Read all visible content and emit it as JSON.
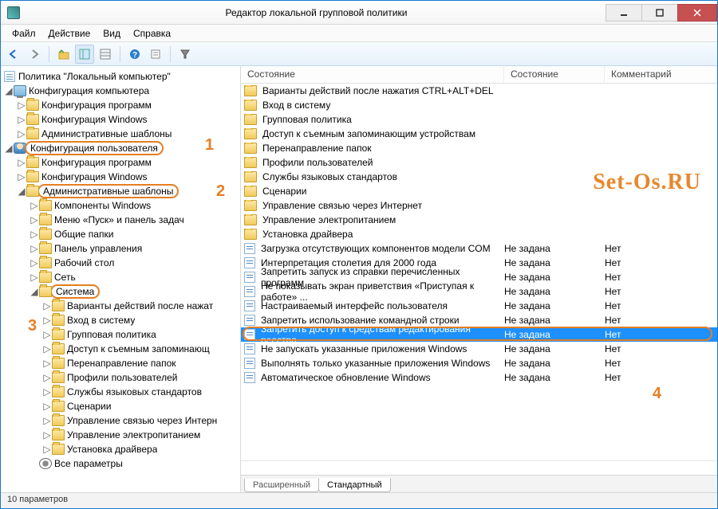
{
  "window": {
    "title": "Редактор локальной групповой политики"
  },
  "menu": {
    "file": "Файл",
    "action": "Действие",
    "view": "Вид",
    "help": "Справка"
  },
  "tree": {
    "root": "Политика \"Локальный компьютер\"",
    "computer_config": "Конфигурация компьютера",
    "computer_children": [
      "Конфигурация программ",
      "Конфигурация Windows",
      "Административные шаблоны"
    ],
    "user_config": "Конфигурация пользователя",
    "user_prog": "Конфигурация программ",
    "user_win": "Конфигурация Windows",
    "admin_templates": "Административные шаблоны",
    "admin_children": [
      "Компоненты Windows",
      "Меню «Пуск» и панель задач",
      "Общие папки",
      "Панель управления",
      "Рабочий стол",
      "Сеть"
    ],
    "system": "Система",
    "system_children": [
      "Варианты действий после нажат",
      "Вход в систему",
      "Групповая политика",
      "Доступ к съемным запоминающ",
      "Перенаправление папок",
      "Профили пользователей",
      "Службы языковых стандартов",
      "Сценарии",
      "Управление связью через Интерн",
      "Управление электропитанием",
      "Установка драйвера"
    ],
    "all_params": "Все параметры"
  },
  "columns": {
    "name": "Состояние",
    "state": "Состояние",
    "comment": "Комментарий"
  },
  "list": {
    "folders": [
      "Варианты действий после нажатия CTRL+ALT+DEL",
      "Вход в систему",
      "Групповая политика",
      "Доступ к съемным запоминающим устройствам",
      "Перенаправление папок",
      "Профили пользователей",
      "Службы языковых стандартов",
      "Сценарии",
      "Управление связью через Интернет",
      "Управление электропитанием",
      "Установка драйвера"
    ],
    "settings": [
      {
        "name": "Загрузка отсутствующих компонентов модели COM",
        "state": "Не задана",
        "comment": "Нет"
      },
      {
        "name": "Интерпретация столетия для 2000 года",
        "state": "Не задана",
        "comment": "Нет"
      },
      {
        "name": "Запретить запуск из справки перечисленных программ",
        "state": "Не задана",
        "comment": "Нет"
      },
      {
        "name": "Не показывать экран приветствия «Приступая к работе» ...",
        "state": "Не задана",
        "comment": "Нет"
      },
      {
        "name": "Настраиваемый интерфейс пользователя",
        "state": "Не задана",
        "comment": "Нет"
      },
      {
        "name": "Запретить использование командной строки",
        "state": "Не задана",
        "comment": "Нет"
      },
      {
        "name": "Запретить доступ к средствам редактирования реестра",
        "state": "Не задана",
        "comment": "Нет",
        "selected": true
      },
      {
        "name": "Не запускать указанные приложения Windows",
        "state": "Не задана",
        "comment": "Нет"
      },
      {
        "name": "Выполнять только указанные приложения Windows",
        "state": "Не задана",
        "comment": "Нет"
      },
      {
        "name": "Автоматическое обновление Windows",
        "state": "Не задана",
        "comment": "Нет"
      }
    ]
  },
  "tabs": {
    "extended": "Расширенный",
    "standard": "Стандартный"
  },
  "status": "10 параметров",
  "annotations": {
    "1": "1",
    "2": "2",
    "3": "3",
    "4": "4"
  },
  "watermark": "Set-Os.RU"
}
